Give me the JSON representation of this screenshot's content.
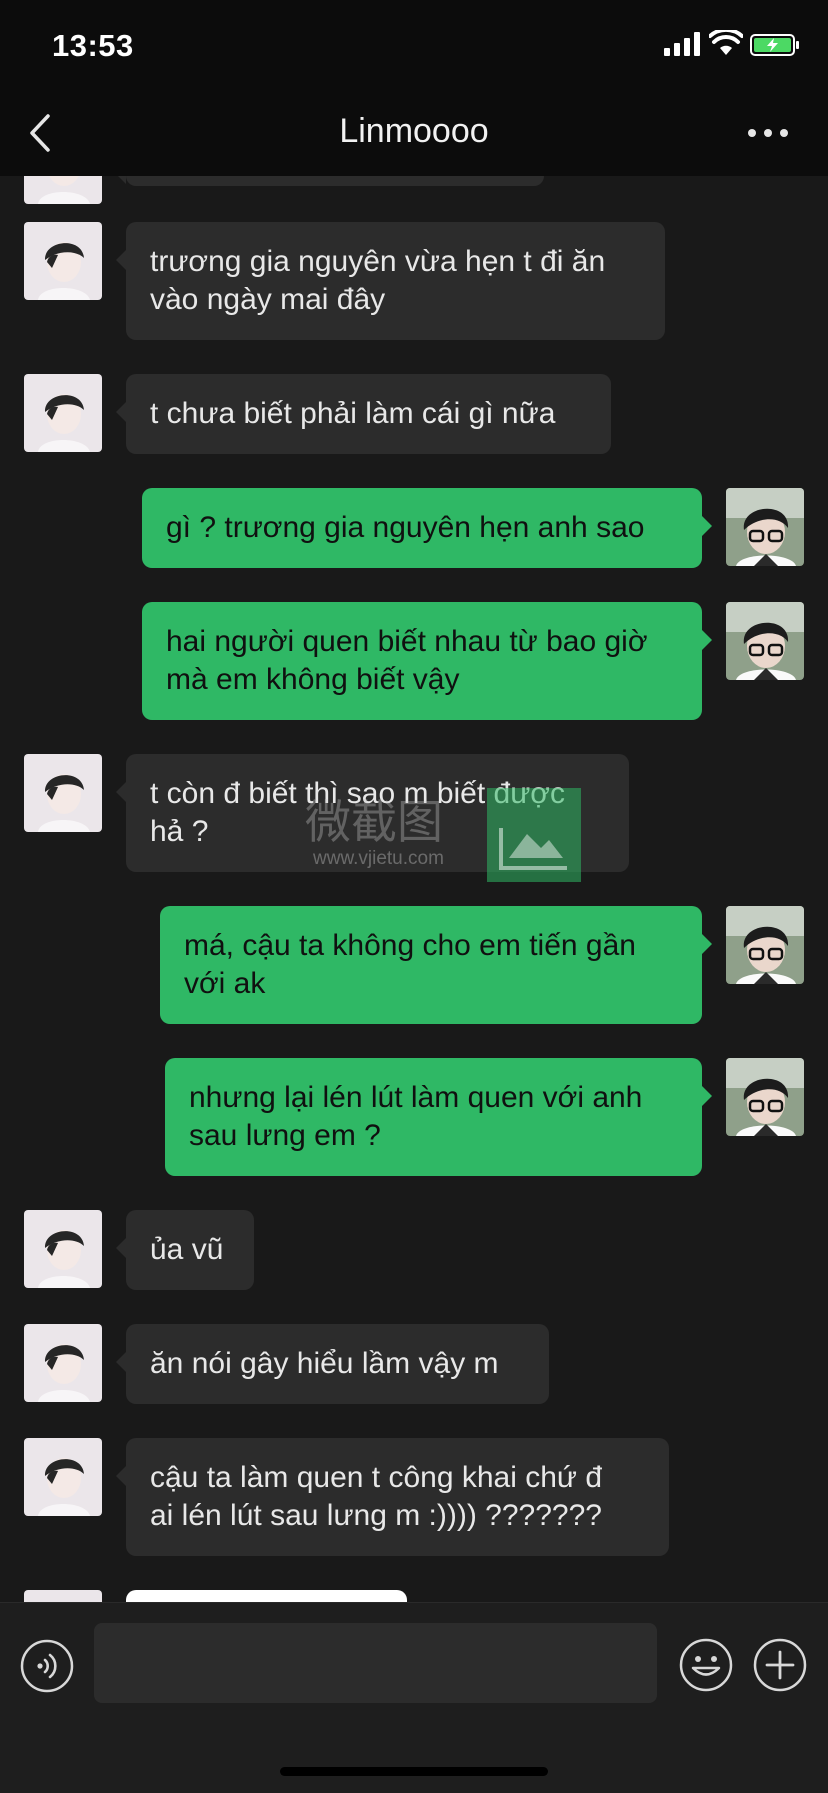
{
  "status_bar": {
    "time": "13:53",
    "icons": [
      "signal-icon",
      "wifi-icon",
      "battery-charging-icon"
    ]
  },
  "header": {
    "title": "Linmoooo",
    "back_icon": "chevron-left-icon",
    "more_icon": "more-dots-icon"
  },
  "messages": [
    {
      "side": "in",
      "text": ""
    },
    {
      "side": "in",
      "text": "trương gia nguyên vừa hẹn t đi ăn\nvào ngày mai đây"
    },
    {
      "side": "in",
      "text": "t chưa biết phải làm cái gì nữa"
    },
    {
      "side": "out",
      "text": "gì ? trương gia nguyên hẹn anh sao"
    },
    {
      "side": "out",
      "text": "hai người quen biết nhau từ bao giờ\nmà em không biết vậy"
    },
    {
      "side": "in",
      "text": "t còn đ biết thì sao m biết được\nhả ?"
    },
    {
      "side": "out",
      "text": "má, cậu ta không cho em tiến gần\nvới ak"
    },
    {
      "side": "out",
      "text": "nhưng lại lén lút làm quen với anh\nsau lưng em ?"
    },
    {
      "side": "in",
      "text": "ủa vũ"
    },
    {
      "side": "in",
      "text": "ăn nói gây hiểu lầm vậy m"
    },
    {
      "side": "in",
      "text": "cậu ta làm quen t công khai chứ đ\nai lén lút sau lưng m :)))) ???????"
    },
    {
      "side": "in",
      "text": ""
    }
  ],
  "watermark": {
    "text": "微截图",
    "url": "www.vjietu.com"
  },
  "input_bar": {
    "placeholder": "",
    "voice_icon": "voice-icon",
    "emoji_icon": "emoji-icon",
    "plus_icon": "plus-icon"
  },
  "colors": {
    "outgoing_bubble": "#2fb865",
    "incoming_bubble": "#2c2c2c",
    "chat_background": "#191919"
  }
}
